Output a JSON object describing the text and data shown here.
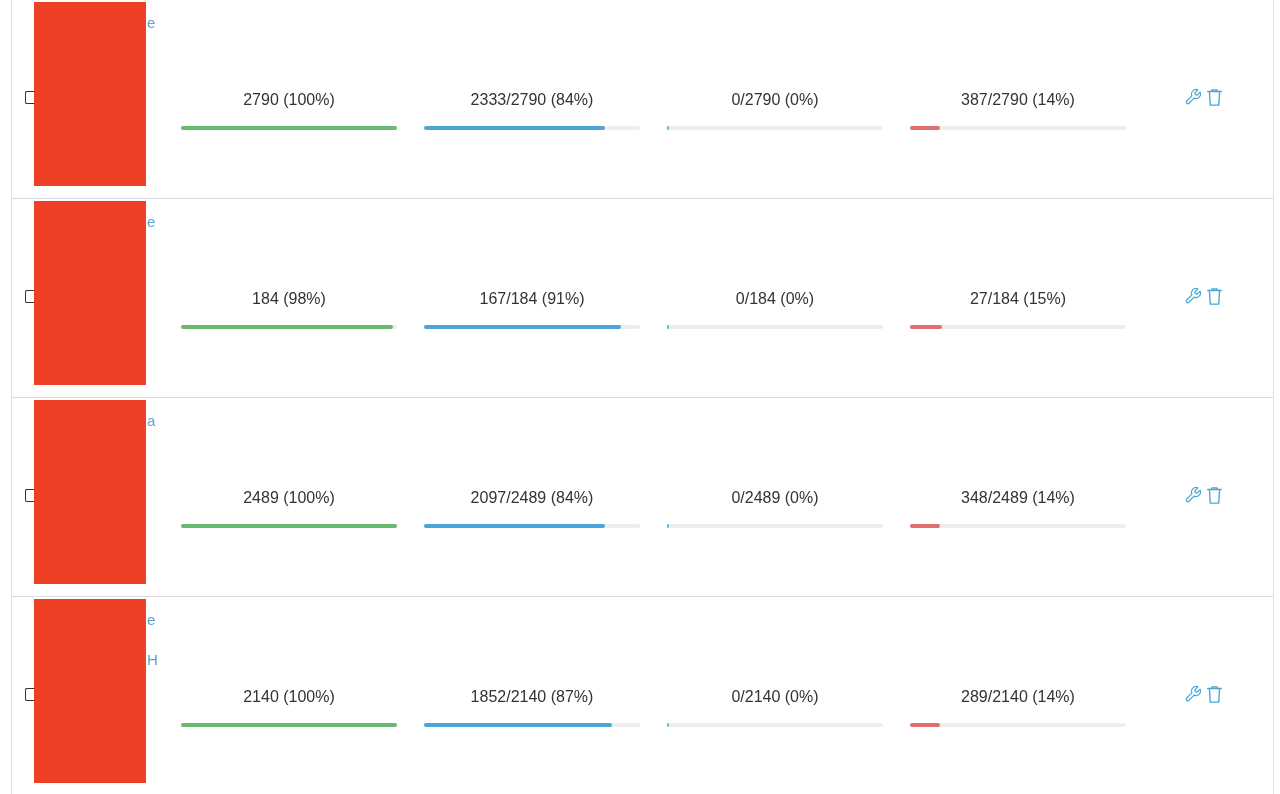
{
  "rows": [
    {
      "checked": false,
      "name_lines": [
        "e"
      ],
      "metrics": [
        {
          "kind": "total",
          "text": "2790 (100%)",
          "level": 1
        },
        {
          "kind": "success",
          "text": "2333/2790 (84%)",
          "level": 0.84
        },
        {
          "kind": "pending",
          "text": "0/2790 (0%)",
          "level": 0
        },
        {
          "kind": "failed",
          "text": "387/2790 (14%)",
          "level": 0.14
        }
      ]
    },
    {
      "checked": false,
      "name_lines": [
        "e"
      ],
      "metrics": [
        {
          "kind": "total",
          "text": "184 (98%)",
          "level": 0.98
        },
        {
          "kind": "success",
          "text": "167/184 (91%)",
          "level": 0.91
        },
        {
          "kind": "pending",
          "text": "0/184 (0%)",
          "level": 0
        },
        {
          "kind": "failed",
          "text": "27/184 (15%)",
          "level": 0.15
        }
      ]
    },
    {
      "checked": false,
      "name_lines": [
        "a"
      ],
      "metrics": [
        {
          "kind": "total",
          "text": "2489 (100%)",
          "level": 1
        },
        {
          "kind": "success",
          "text": "2097/2489 (84%)",
          "level": 0.84
        },
        {
          "kind": "pending",
          "text": "0/2489 (0%)",
          "level": 0
        },
        {
          "kind": "failed",
          "text": "348/2489 (14%)",
          "level": 0.14
        }
      ]
    },
    {
      "checked": false,
      "name_lines": [
        "e",
        "H"
      ],
      "metrics": [
        {
          "kind": "total",
          "text": "2140 (100%)",
          "level": 1
        },
        {
          "kind": "success",
          "text": "1852/2140 (87%)",
          "level": 0.87
        },
        {
          "kind": "pending",
          "text": "0/2140 (0%)",
          "level": 0
        },
        {
          "kind": "failed",
          "text": "289/2140 (14%)",
          "level": 0.14
        }
      ]
    }
  ]
}
